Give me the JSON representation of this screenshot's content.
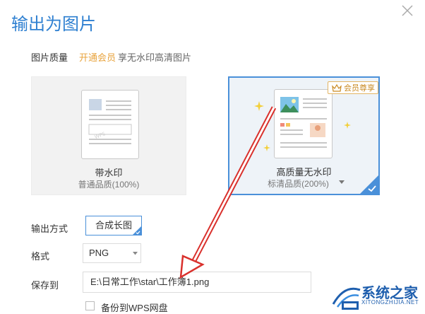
{
  "dialog": {
    "title": "输出为图片"
  },
  "quality": {
    "label": "图片质量",
    "vip_link": "开通会员",
    "vip_desc": "享无水印高清图片",
    "options": [
      {
        "title": "带水印",
        "subtitle": "普通品质(100%)",
        "selected": false
      },
      {
        "title": "高质量无水印",
        "subtitle": "标清品质(200%)",
        "selected": true,
        "badge": "会员尊享"
      }
    ]
  },
  "output": {
    "label": "输出方式",
    "value": "合成长图"
  },
  "format": {
    "label": "格式",
    "value": "PNG"
  },
  "save": {
    "label": "保存到",
    "path": "E:\\日常工作\\star\\工作簿1.png"
  },
  "backup": {
    "label": "备份到WPS网盘",
    "checked": false
  },
  "watermark_logo": {
    "name": "系统之家",
    "url": "XITONGZHIJIA.NET"
  },
  "colors": {
    "accent": "#4a90d9",
    "title": "#2f80d1",
    "vip": "#e8a33d",
    "arrow": "#d9302c"
  }
}
